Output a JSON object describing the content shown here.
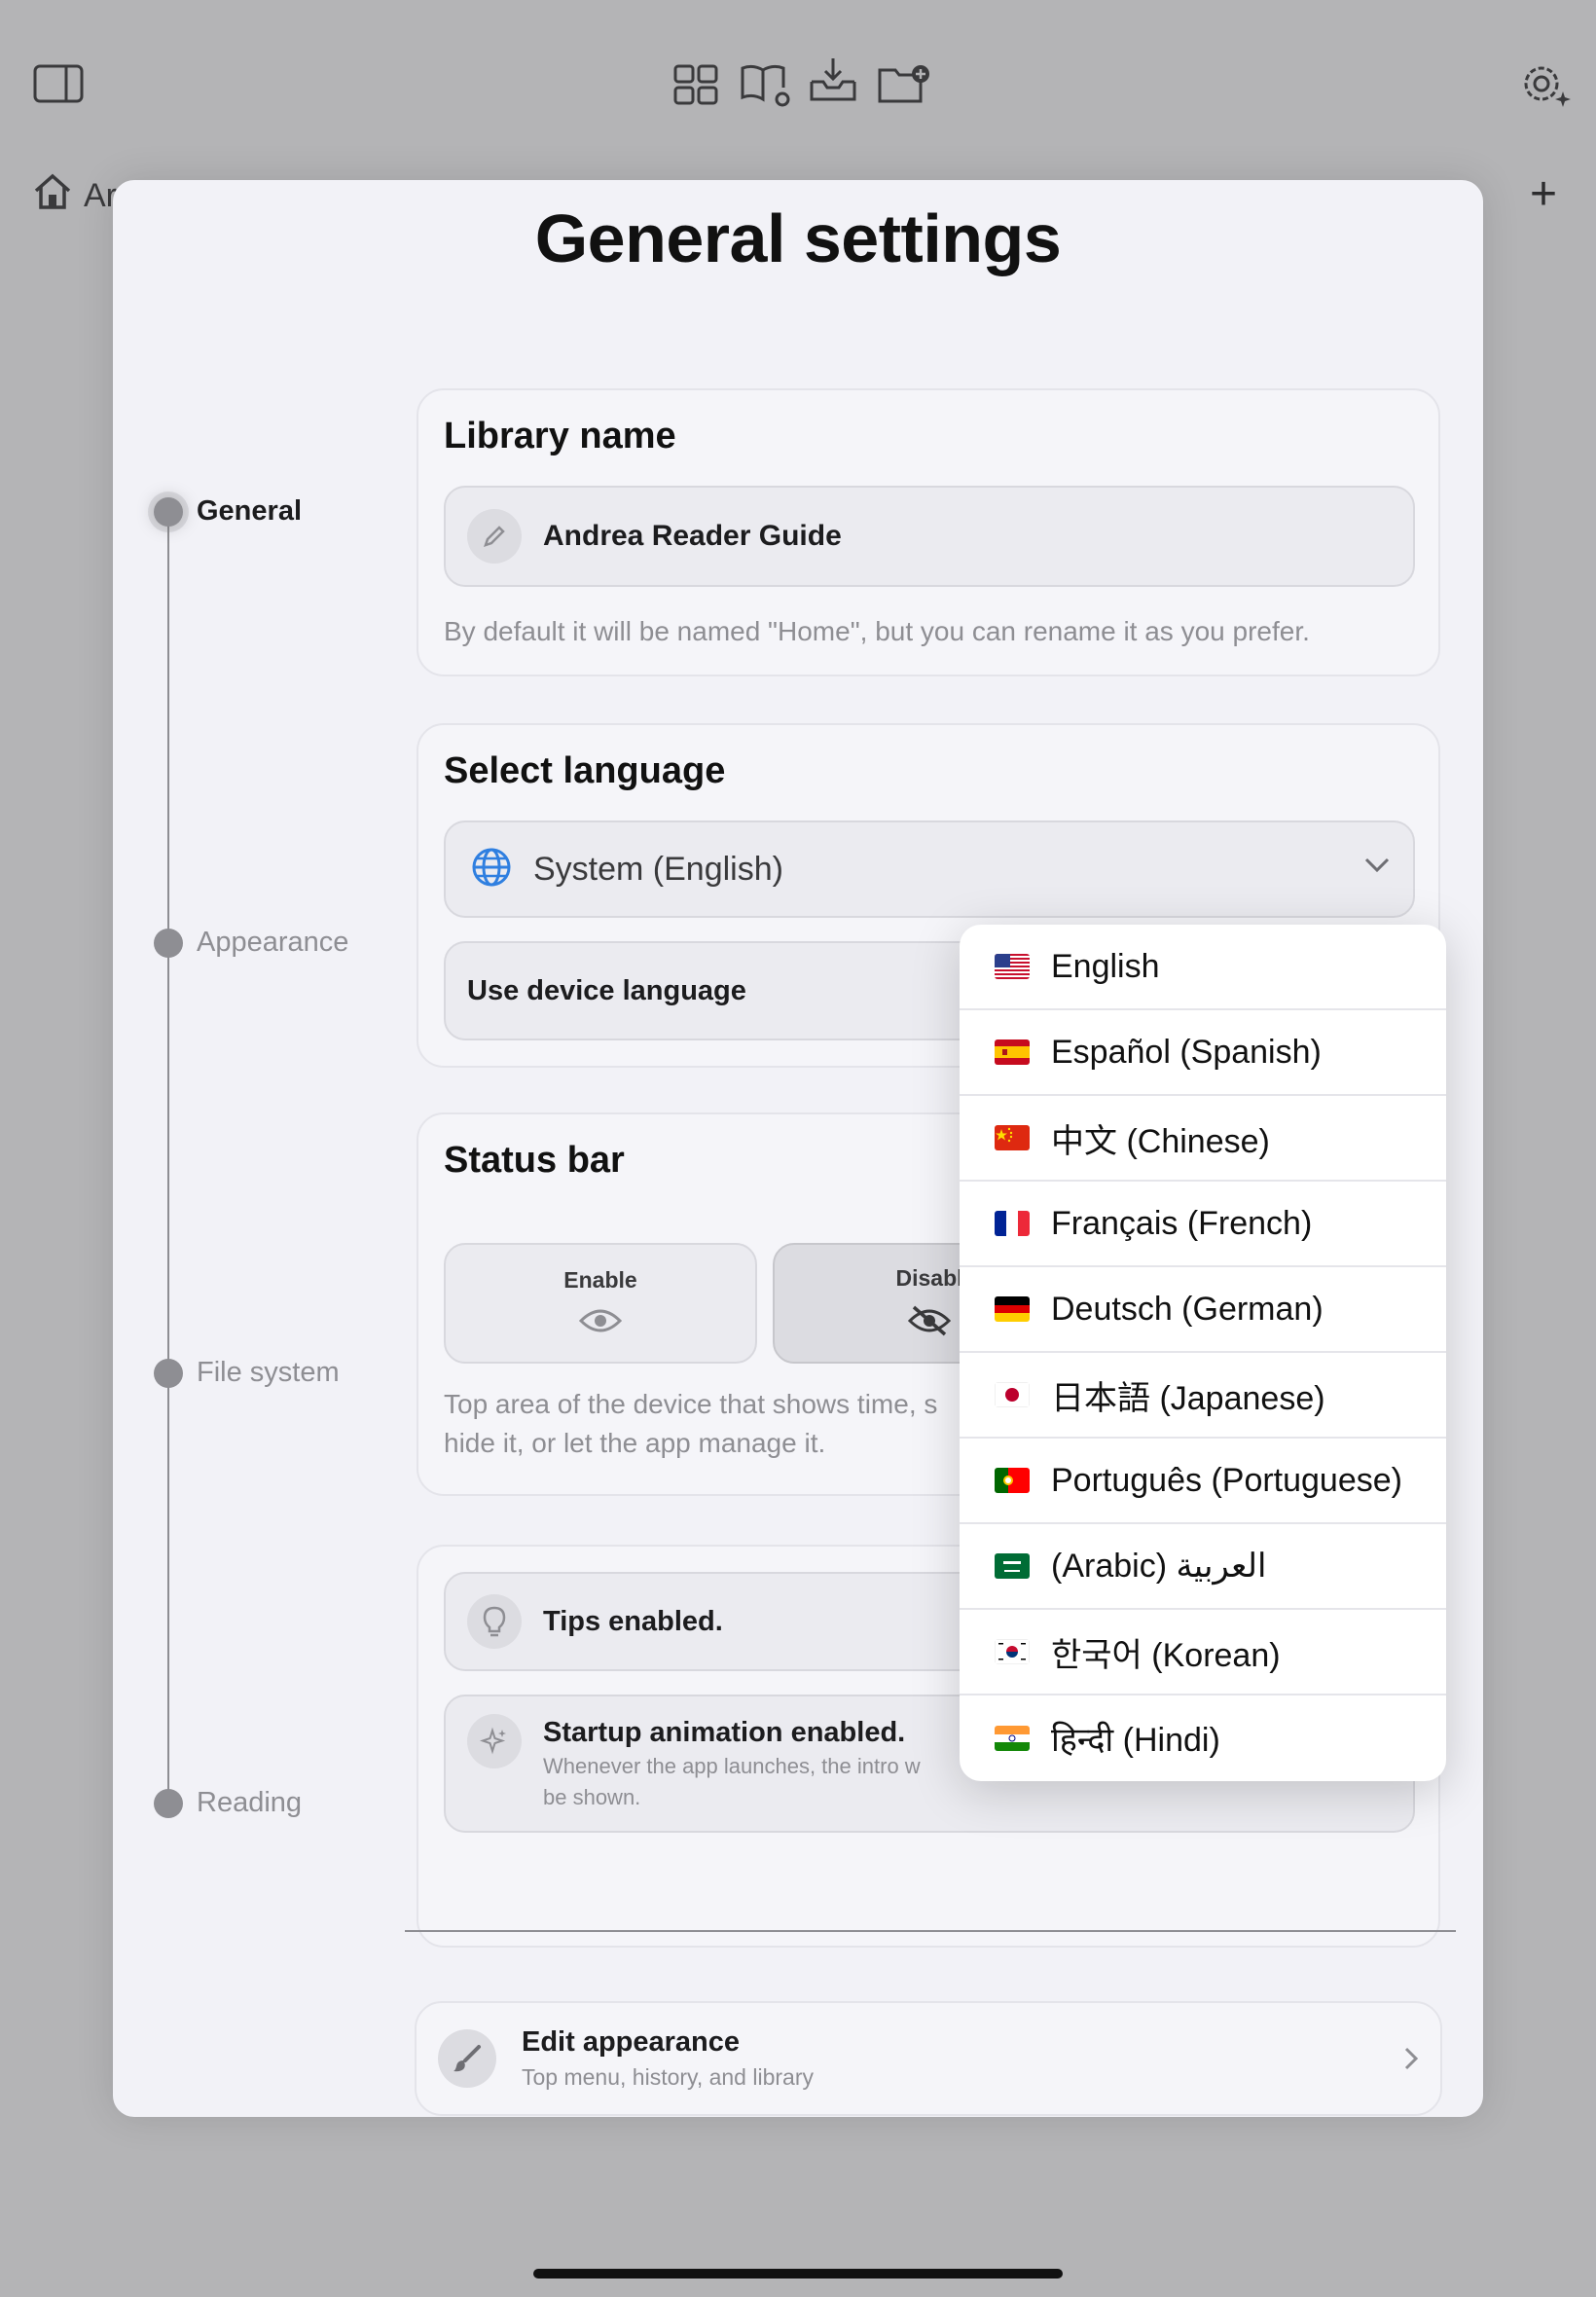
{
  "background": {
    "home_label": "Ar",
    "toolbar_icons": [
      "sidebar-toggle-icon",
      "grid-icon",
      "book-settings-icon",
      "inbox-download-icon",
      "folder-add-icon",
      "settings-icon"
    ]
  },
  "sheet": {
    "title": "General settings"
  },
  "timeline": {
    "items": [
      {
        "label": "General",
        "active": true
      },
      {
        "label": "Appearance",
        "active": false
      },
      {
        "label": "File system",
        "active": false
      },
      {
        "label": "Reading",
        "active": false
      }
    ]
  },
  "library": {
    "title": "Library name",
    "value": "Andrea Reader Guide",
    "helper": "By default it will be named \"Home\", but you can rename it as you prefer."
  },
  "language": {
    "title": "Select language",
    "selected": "System (English)",
    "device_toggle_label": "Use device language"
  },
  "status_bar": {
    "title": "Status bar",
    "enable_label": "Enable",
    "disable_label": "Disabl",
    "helper_line1": "Top area of the device that shows time, s",
    "helper_line2": "hide it, or let the app manage it."
  },
  "tips": {
    "tips_label": "Tips enabled.",
    "startup_label": "Startup animation enabled.",
    "startup_desc_line1": "Whenever the app launches, the intro w",
    "startup_desc_line2": "be shown."
  },
  "edit_appearance": {
    "title": "Edit appearance",
    "subtitle": "Top menu, history, and library"
  },
  "dropdown": {
    "options": [
      {
        "label": "English",
        "flag": "us"
      },
      {
        "label": "Español (Spanish)",
        "flag": "es"
      },
      {
        "label": "中文 (Chinese)",
        "flag": "cn"
      },
      {
        "label": "Français (French)",
        "flag": "fr"
      },
      {
        "label": "Deutsch (German)",
        "flag": "de"
      },
      {
        "label": "日本語 (Japanese)",
        "flag": "jp"
      },
      {
        "label": "Português (Portuguese)",
        "flag": "pt"
      },
      {
        "label": "(Arabic) العربية",
        "flag": "sa"
      },
      {
        "label": "한국어 (Korean)",
        "flag": "kr"
      },
      {
        "label": "हिन्दी (Hindi)",
        "flag": "in"
      }
    ]
  }
}
